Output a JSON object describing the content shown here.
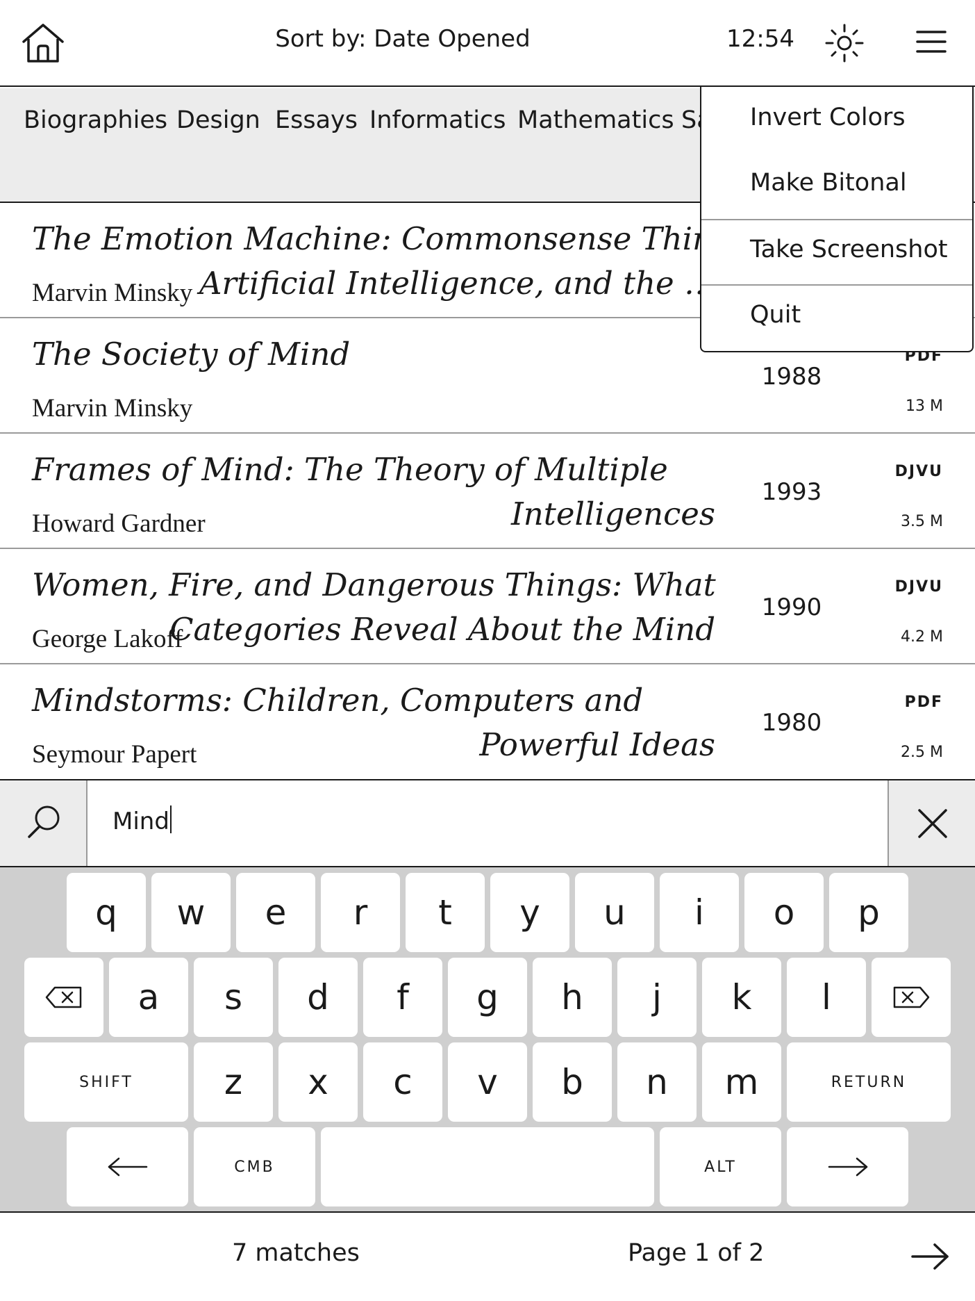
{
  "topbar": {
    "home_icon": "home-icon",
    "sort_label": "Sort by: Date Opened",
    "clock": "12:54",
    "frontlight_icon": "sun-icon",
    "menu_icon": "hamburger-menu-icon"
  },
  "categories": [
    "Biographies",
    "Design",
    "Essays",
    "Informatics",
    "Mathematics",
    "Sa"
  ],
  "books": [
    {
      "title_line1": "The Emotion Machine: Commonsense Thinking,",
      "title_line2": "Artificial Intelligence, and the …",
      "author": "Marvin Minsky",
      "year": "",
      "format": "",
      "size": ""
    },
    {
      "title_line1": "The Society of Mind",
      "title_line2": "",
      "author": "Marvin Minsky",
      "year": "1988",
      "format": "PDF",
      "size": "13 M"
    },
    {
      "title_line1": "Frames of Mind: The Theory of Multiple",
      "title_line2": "Intelligences",
      "author": "Howard Gardner",
      "year": "1993",
      "format": "DJVU",
      "size": "3.5 M"
    },
    {
      "title_line1": "Women, Fire, and Dangerous Things: What",
      "title_line2": "Categories Reveal About the Mind",
      "author": "George Lakoff",
      "year": "1990",
      "format": "DJVU",
      "size": "4.2 M"
    },
    {
      "title_line1": "Mindstorms: Children, Computers and",
      "title_line2": "Powerful Ideas",
      "author": "Seymour Papert",
      "year": "1980",
      "format": "PDF",
      "size": "2.5 M"
    }
  ],
  "popup_menu": {
    "items": [
      "Invert Colors",
      "Make Bitonal",
      "Take Screenshot",
      "Quit"
    ]
  },
  "search": {
    "icon": "search-icon",
    "value": "Mind",
    "clear_icon": "close-icon"
  },
  "keyboard": {
    "row1": [
      "q",
      "w",
      "e",
      "r",
      "t",
      "y",
      "u",
      "i",
      "o",
      "p"
    ],
    "row2": [
      "a",
      "s",
      "d",
      "f",
      "g",
      "h",
      "j",
      "k",
      "l"
    ],
    "row3": [
      "z",
      "x",
      "c",
      "v",
      "b",
      "n",
      "m"
    ],
    "shift_label": "SHIFT",
    "return_label": "RETURN",
    "cmb_label": "CMB",
    "alt_label": "ALT",
    "backspace_icon": "backspace-icon",
    "delete_forward_icon": "delete-forward-icon",
    "left_arrow_icon": "arrow-left-icon",
    "right_arrow_icon": "arrow-right-icon"
  },
  "footer": {
    "matches": "7 matches",
    "page_info": "Page 1 of 2",
    "next_icon": "arrow-right-icon"
  }
}
